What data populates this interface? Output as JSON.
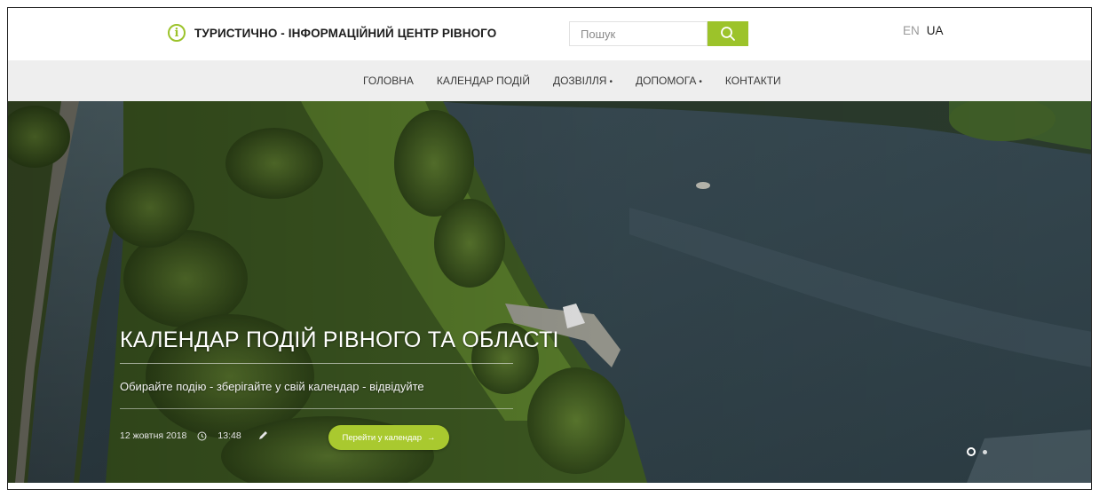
{
  "header": {
    "brand_title": "ТУРИСТИЧНО - ІНФОРМАЦІЙНИЙ ЦЕНТР РІВНОГО",
    "brand_icon": "info-circle-icon",
    "search": {
      "placeholder": "Пошук",
      "button_icon": "search-icon"
    },
    "languages": [
      {
        "label": "EN",
        "active": false
      },
      {
        "label": "UA",
        "active": true
      }
    ]
  },
  "nav": {
    "items": [
      {
        "label": "ГОЛОВНА",
        "dot": ""
      },
      {
        "label": "КАЛЕНДАР ПОДІЙ",
        "dot": ""
      },
      {
        "label": "ДОЗВІЛЛЯ",
        "dot": "•"
      },
      {
        "label": "ДОПОМОГА",
        "dot": "•"
      },
      {
        "label": "КОНТАКТИ",
        "dot": ""
      }
    ]
  },
  "hero": {
    "title": "КАЛЕНДАР ПОДІЙ РІВНОГО ТА ОБЛАСТІ",
    "subtitle": "Обирайте подію - зберігайте у свій календар - відвідуйте",
    "date": "12 жовтня 2018",
    "time": "13:48",
    "cta_label": "Перейти у календар",
    "cta_arrow": "→",
    "slides_total": 2,
    "active_slide": 1
  },
  "colors": {
    "accent": "#9cc32a",
    "nav_bg": "#eeeeee",
    "text": "#1d1d1d"
  }
}
